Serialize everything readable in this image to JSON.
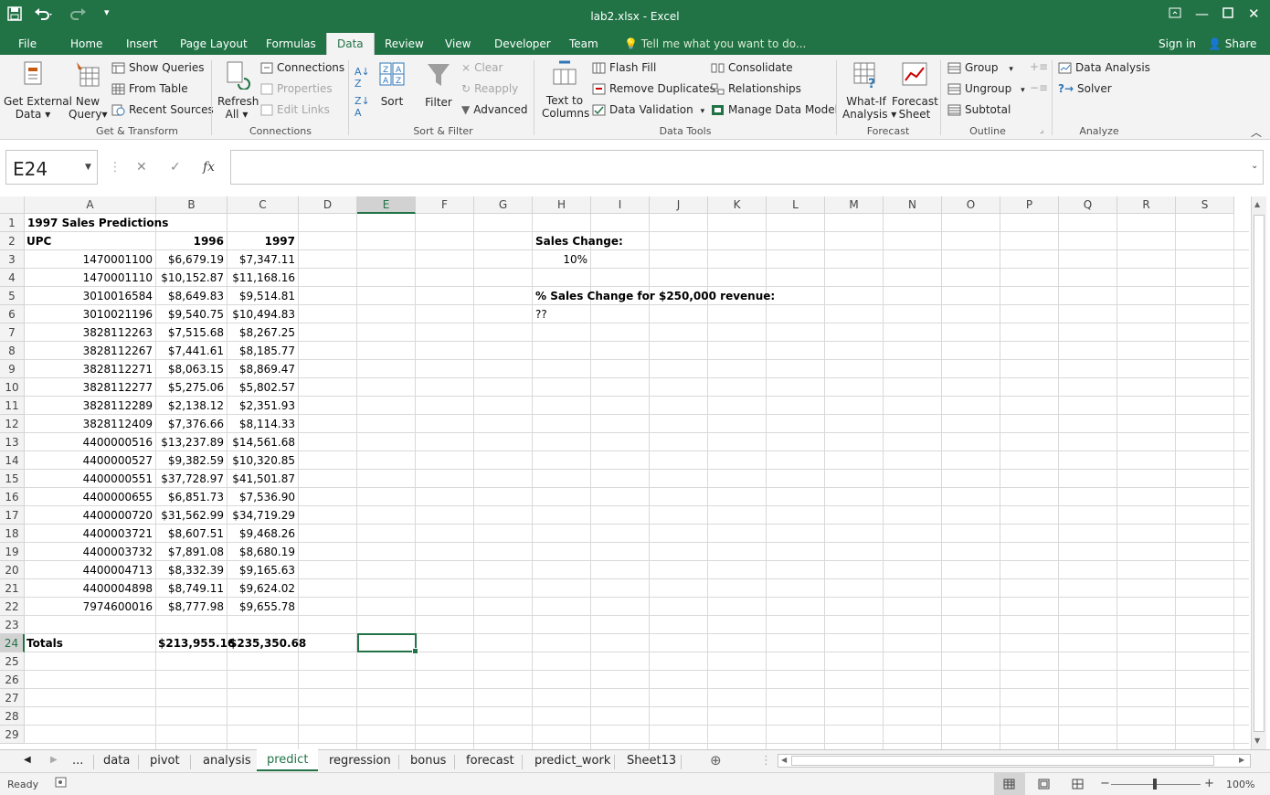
{
  "title": "lab2.xlsx - Excel",
  "quick_access": {
    "save_icon": "save-icon",
    "undo_icon": "undo-icon",
    "redo_icon": "redo-icon"
  },
  "ribbon_tabs": [
    "File",
    "Home",
    "Insert",
    "Page Layout",
    "Formulas",
    "Data",
    "Review",
    "View",
    "Developer",
    "Team"
  ],
  "active_tab": "Data",
  "tell_me": "Tell me what you want to do...",
  "sign_in": "Sign in",
  "share": "Share",
  "ribbon": {
    "get_external_1": "Get External",
    "get_external_2": "Data",
    "new_query_1": "New",
    "new_query_2": "Query",
    "show_queries": "Show Queries",
    "from_table": "From Table",
    "recent_sources": "Recent Sources",
    "group_get": "Get & Transform",
    "refresh_1": "Refresh",
    "refresh_2": "All",
    "connections": "Connections",
    "properties": "Properties",
    "edit_links": "Edit Links",
    "group_connections": "Connections",
    "sort": "Sort",
    "filter": "Filter",
    "clear": "Clear",
    "reapply": "Reapply",
    "advanced": "Advanced",
    "group_sort": "Sort & Filter",
    "text_to_1": "Text to",
    "text_to_2": "Columns",
    "flash_fill": "Flash Fill",
    "remove_dup": "Remove Duplicates",
    "data_validation": "Data Validation",
    "consolidate": "Consolidate",
    "relationships": "Relationships",
    "manage_model": "Manage Data Model",
    "group_tools": "Data Tools",
    "whatif_1": "What-If",
    "whatif_2": "Analysis",
    "forecast_1": "Forecast",
    "forecast_2": "Sheet",
    "group_forecast": "Forecast",
    "group": "Group",
    "ungroup": "Ungroup",
    "subtotal": "Subtotal",
    "group_outline": "Outline",
    "data_analysis": "Data Analysis",
    "solver": "Solver",
    "group_analyze": "Analyze"
  },
  "namebox": "E24",
  "formula": "",
  "columns": [
    "A",
    "B",
    "C",
    "D",
    "E",
    "F",
    "G",
    "H",
    "I",
    "J",
    "K",
    "L",
    "M",
    "N",
    "O",
    "P",
    "Q",
    "R",
    "S"
  ],
  "rows": [
    "1",
    "2",
    "3",
    "4",
    "5",
    "6",
    "7",
    "8",
    "9",
    "10",
    "11",
    "12",
    "13",
    "14",
    "15",
    "16",
    "17",
    "18",
    "19",
    "20",
    "21",
    "22",
    "23",
    "24",
    "25",
    "26",
    "27",
    "28",
    "29"
  ],
  "cells": {
    "title": "1997 Sales Predictions",
    "hdr_upc": "UPC",
    "hdr_1996": "1996",
    "hdr_1997": "1997",
    "data": [
      [
        "1470001100",
        "$6,679.19",
        "$7,347.11"
      ],
      [
        "1470001110",
        "$10,152.87",
        "$11,168.16"
      ],
      [
        "3010016584",
        "$8,649.83",
        "$9,514.81"
      ],
      [
        "3010021196",
        "$9,540.75",
        "$10,494.83"
      ],
      [
        "3828112263",
        "$7,515.68",
        "$8,267.25"
      ],
      [
        "3828112267",
        "$7,441.61",
        "$8,185.77"
      ],
      [
        "3828112271",
        "$8,063.15",
        "$8,869.47"
      ],
      [
        "3828112277",
        "$5,275.06",
        "$5,802.57"
      ],
      [
        "3828112289",
        "$2,138.12",
        "$2,351.93"
      ],
      [
        "3828112409",
        "$7,376.66",
        "$8,114.33"
      ],
      [
        "4400000516",
        "$13,237.89",
        "$14,561.68"
      ],
      [
        "4400000527",
        "$9,382.59",
        "$10,320.85"
      ],
      [
        "4400000551",
        "$37,728.97",
        "$41,501.87"
      ],
      [
        "4400000655",
        "$6,851.73",
        "$7,536.90"
      ],
      [
        "4400000720",
        "$31,562.99",
        "$34,719.29"
      ],
      [
        "4400003721",
        "$8,607.51",
        "$9,468.26"
      ],
      [
        "4400003732",
        "$7,891.08",
        "$8,680.19"
      ],
      [
        "4400004713",
        "$8,332.39",
        "$9,165.63"
      ],
      [
        "4400004898",
        "$8,749.11",
        "$9,624.02"
      ],
      [
        "7974600016",
        "$8,777.98",
        "$9,655.78"
      ]
    ],
    "totals_label": "Totals",
    "total_1996": "$213,955.16",
    "total_1997": "$235,350.68",
    "sales_change_label": "Sales Change:",
    "sales_change_value": "10%",
    "pct_label": "% Sales Change for $250,000 revenue:",
    "pct_value": "??"
  },
  "sheets": [
    "...",
    "data",
    "pivot",
    "analysis",
    "predict",
    "regression",
    "bonus",
    "forecast",
    "predict_work",
    "Sheet13"
  ],
  "active_sheet": "predict",
  "status": "Ready",
  "zoom": "100%"
}
